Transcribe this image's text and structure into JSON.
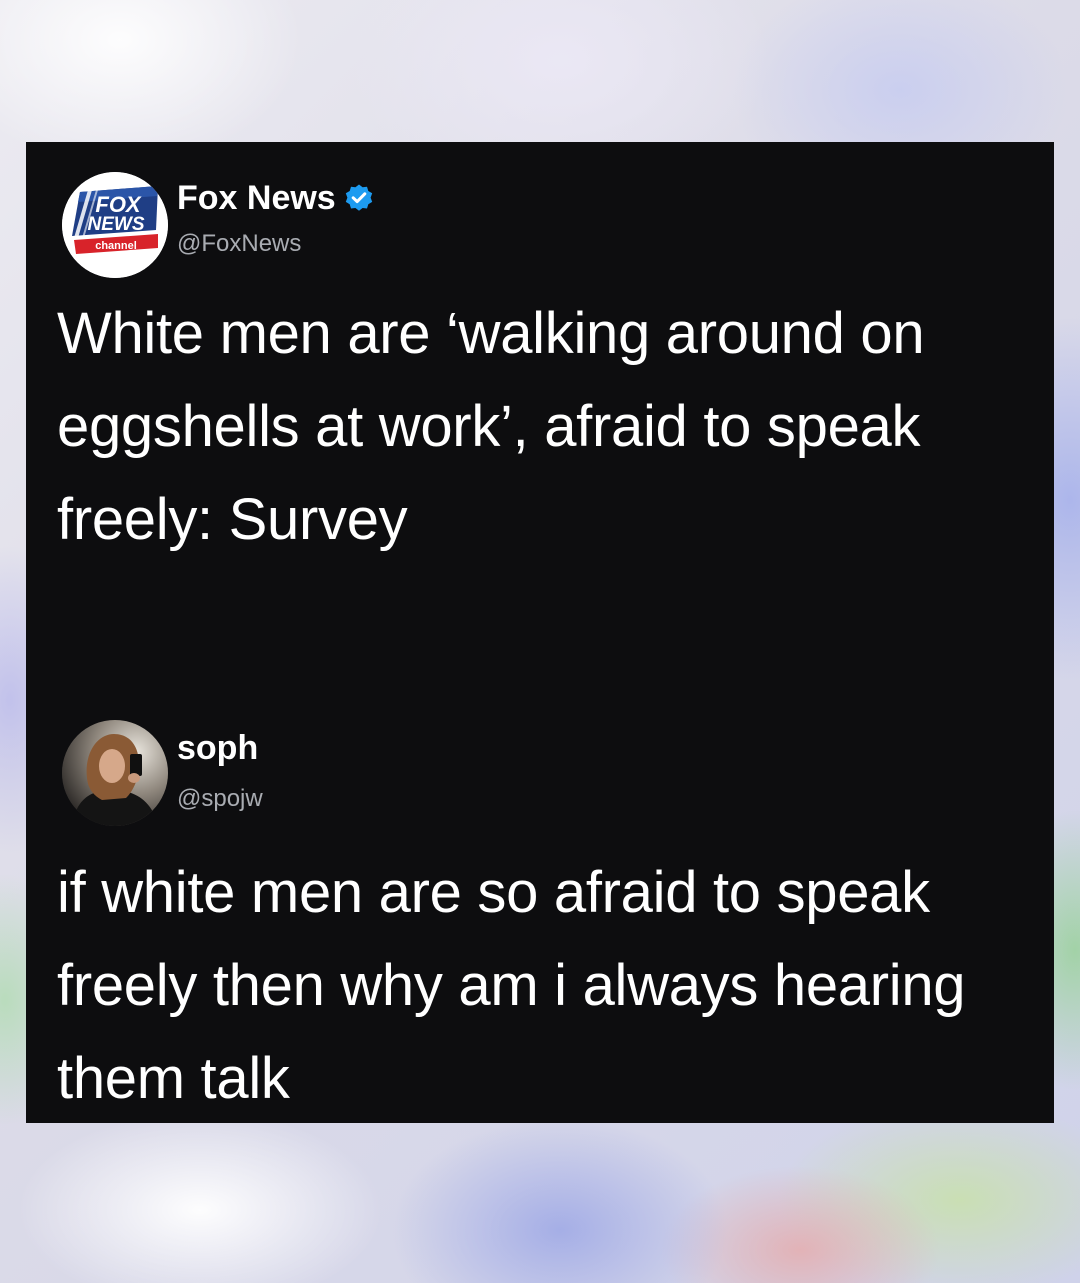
{
  "posts": [
    {
      "display_name": "Fox News",
      "handle": "@FoxNews",
      "verified": true,
      "avatar_icon": "fox-news-channel-logo",
      "avatar_logo_text": [
        "FOX",
        "NEWS",
        "channel"
      ],
      "text": "White men are ‘walking around on eggshells at work’, afraid to speak freely: Survey"
    },
    {
      "display_name": "soph",
      "handle": "@spojw",
      "verified": false,
      "avatar_icon": "profile-photo-avatar",
      "text": "if white men are so afraid to speak freely then why am i always hearing them talk"
    }
  ],
  "colors": {
    "card_background": "#0d0d0f",
    "primary_text": "#ffffff",
    "secondary_text": "#a9acb2",
    "verified_badge": "#1d9bf0",
    "fox_blue": "#1f3e85",
    "fox_red": "#d8232a"
  }
}
